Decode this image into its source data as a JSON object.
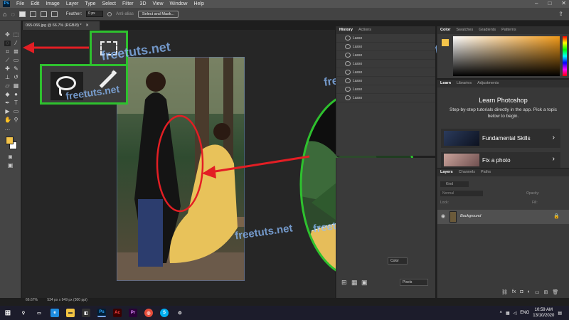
{
  "menu": {
    "app_icon": "Ps",
    "items": [
      "File",
      "Edit",
      "Image",
      "Layer",
      "Type",
      "Select",
      "Filter",
      "3D",
      "View",
      "Window",
      "Help"
    ]
  },
  "options_bar": {
    "feather_label": "Feather:",
    "feather_value": "0 px",
    "antialias_label": "Anti-alias",
    "select_mask_button": "Select and Mask..."
  },
  "document": {
    "tab_title": "065-066.jpg @ 66.7% (RGB/8) *",
    "zoom": "66.67%",
    "doc_info": "534 px x 949 px (300 ppi)"
  },
  "history_panel": {
    "tabs": [
      "History",
      "Actions"
    ],
    "rows": [
      "Lasso",
      "Lasso",
      "Lasso",
      "Lasso",
      "Lasso",
      "Lasso",
      "Lasso",
      "Lasso"
    ]
  },
  "color_panel": {
    "tabs": [
      "Color",
      "Swatches",
      "Gradients",
      "Patterns"
    ]
  },
  "learn_panel": {
    "tabs": [
      "Learn",
      "Libraries",
      "Adjustments"
    ],
    "title": "Learn Photoshop",
    "desc": "Step-by-step tutorials directly in the app. Pick a topic below to begin.",
    "cards": [
      "Fundamental Skills",
      "Fix a photo"
    ]
  },
  "layers_panel": {
    "tabs": [
      "Layers",
      "Channels",
      "Paths"
    ],
    "kind": "Kind",
    "blend": "Normal",
    "opacity_label": "Opacity:",
    "lock_label": "Lock:",
    "fill_label": "Fill:",
    "layer_name": "Background"
  },
  "sub_panel": {
    "pixels_select": "Pixels",
    "color_field": "Color"
  },
  "watermark": "freetuts.net",
  "taskbar": {
    "search_icon": "search-icon",
    "lang": "ENG",
    "time": "10:59 AM",
    "date": "13/10/2020"
  },
  "colors": {
    "highlight_red": "#e31e24",
    "highlight_green": "#2ec12e",
    "fg_swatch": "#f4c44a",
    "accent_blue": "#31a8ff"
  }
}
